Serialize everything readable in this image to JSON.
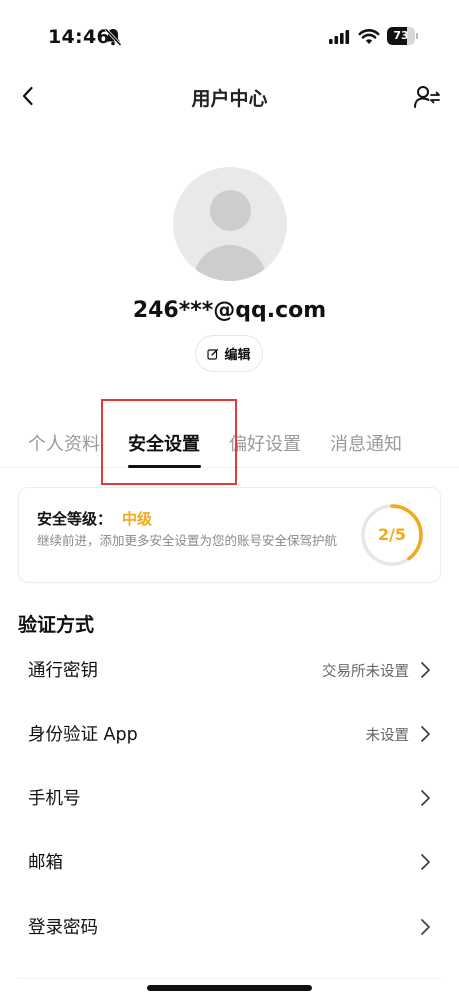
{
  "status_bar": {
    "time": "14:46",
    "battery": "73",
    "battery_level": 0.73
  },
  "nav": {
    "title": "用户中心"
  },
  "profile": {
    "email": "246***@qq.com",
    "edit_label": "编辑"
  },
  "tabs": [
    {
      "label": "个人资料",
      "active": false
    },
    {
      "label": "安全设置",
      "active": true
    },
    {
      "label": "偏好设置",
      "active": false
    },
    {
      "label": "消息通知",
      "active": false
    }
  ],
  "security": {
    "title": "安全等级：",
    "level": "中级",
    "description": "继续前进，添加更多安全设置为您的账号安全保驾护航",
    "progress_text": "2/5",
    "progress_value": 2,
    "progress_total": 5
  },
  "verification": {
    "section_title": "验证方式",
    "items": [
      {
        "label": "通行密钥",
        "value": "交易所未设置"
      },
      {
        "label": "身份验证 App",
        "value": "未设置"
      },
      {
        "label": "手机号",
        "value": ""
      },
      {
        "label": "邮箱",
        "value": ""
      },
      {
        "label": "登录密码",
        "value": ""
      }
    ]
  },
  "colors": {
    "accent": "#f2a91c",
    "highlight": "#e03a3a"
  }
}
